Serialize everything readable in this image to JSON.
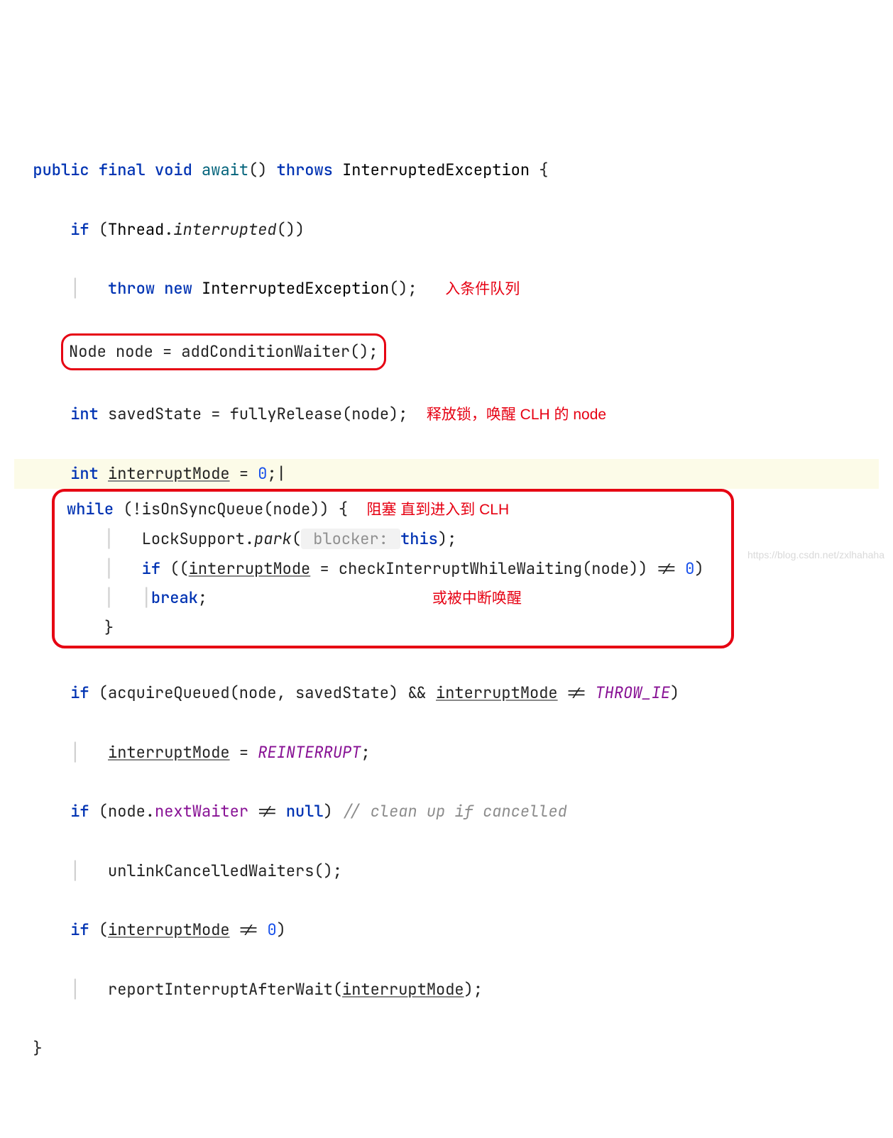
{
  "sig": {
    "public": "public",
    "final": "final",
    "void": "void",
    "method": "await",
    "parens": "()",
    "throws": "throws",
    "exc": "InterruptedException",
    "open": " {"
  },
  "l2": {
    "if": "if",
    "open": " (",
    "thread": "Thread",
    "dot": ".",
    "intr": "interrupted",
    "close": "())"
  },
  "l3": {
    "throw": "throw",
    "new": "new",
    "exc": "InterruptedException",
    "tail": "();"
  },
  "box1": {
    "text": "Node node = addConditionWaiter();"
  },
  "ann1": "入条件队列",
  "l5": {
    "int": "int",
    "rest": " savedState = fullyRelease(node);"
  },
  "ann2": "释放锁，唤醒 CLH 的 node",
  "l6": {
    "int": "int",
    "sp": " ",
    "var": "interruptMode",
    "eq": " = ",
    "zero": "0",
    "semi": ";"
  },
  "big": {
    "w": "while",
    "cond": " (!isOnSyncQueue(node)) {",
    "ann3": "阻塞 直到进入到 CLH",
    "line2a": "LockSupport.",
    "park": "park",
    "line2b": "(",
    "hint": " blocker: ",
    "thiskw": "this",
    "line2c": ");",
    "ifkw": "if",
    "ifrest1": " ((",
    "imode": "interruptMode",
    "ifrest2": " = checkInterruptWhileWaiting(node)) != ",
    "zero": "0",
    "ifrest3": ")",
    "brk": "break",
    "brksemi": ";",
    "ann4": "或被中断唤醒",
    "close": "}"
  },
  "l11": {
    "if": "if",
    "a": " (acquireQueued(node, savedState) && ",
    "im": "interruptMode",
    "b": " != ",
    "thr": "THROW_IE",
    "c": ")"
  },
  "l12": {
    "im": "interruptMode",
    "eq": " = ",
    "re": "REINTERRUPT",
    "semi": ";"
  },
  "l13": {
    "if": "if",
    "a": " (node.",
    "nw": "nextWaiter",
    "b": " != ",
    "null": "null",
    "c": ") ",
    "cm": "// clean up if cancelled"
  },
  "l14": "unlinkCancelledWaiters();",
  "l15": {
    "if": "if",
    "a": " (",
    "im": "interruptMode",
    "b": " != ",
    "zero": "0",
    "c": ")"
  },
  "l16a": "reportInterruptAfterWait(",
  "l16im": "interruptMode",
  "l16b": ");",
  "closeBrace": "}",
  "watermark": "https://blog.csdn.net/zxlhahaha"
}
